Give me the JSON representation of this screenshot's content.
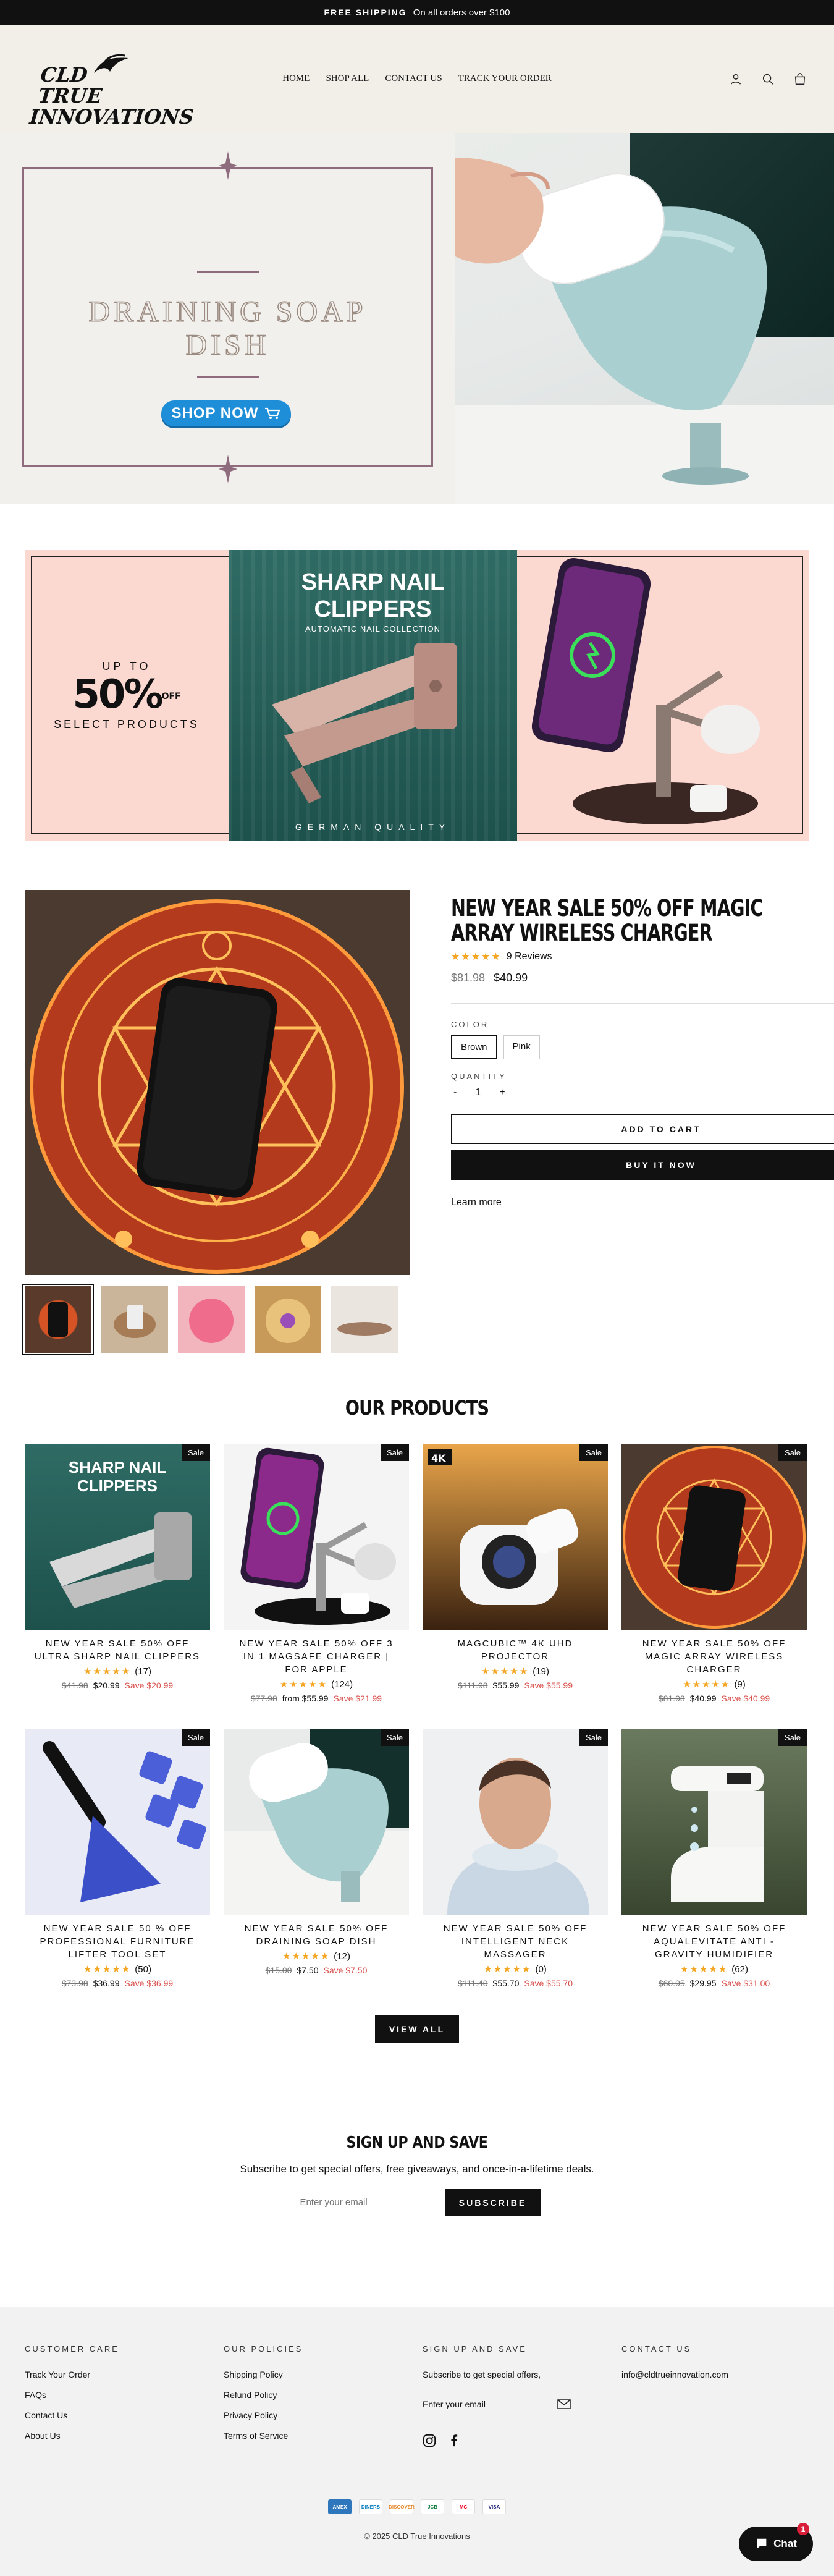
{
  "announcement": {
    "bold": "FREE SHIPPING",
    "text": "On all orders over $100"
  },
  "logo": {
    "line1": "CLD TRUE",
    "line2": "INNOVATIONS"
  },
  "nav": [
    "HOME",
    "SHOP ALL",
    "CONTACT US",
    "TRACK YOUR ORDER"
  ],
  "hero": {
    "title_line1": "DRAINING SOAP",
    "title_line2": "DISH",
    "button": "SHOP NOW"
  },
  "promo": {
    "up_to": "UP TO",
    "percent": "50%",
    "off": "OFF",
    "select": "SELECT PRODUCTS",
    "mid_title_1": "SHARP NAIL",
    "mid_title_2": "CLIPPERS",
    "mid_sub": "AUTOMATIC NAIL COLLECTION",
    "mid_footer": "GERMAN QUALITY"
  },
  "featured": {
    "title": "NEW YEAR SALE 50% OFF MAGIC ARRAY WIRELESS CHARGER",
    "stars": "★★★★★",
    "reviews": "9 Reviews",
    "price_old": "$81.98",
    "price_new": "$40.99",
    "color_label": "COLOR",
    "colors": [
      "Brown",
      "Pink"
    ],
    "quantity_label": "QUANTITY",
    "qty_minus": "-",
    "qty_value": "1",
    "qty_plus": "+",
    "add_to_cart": "ADD TO CART",
    "buy_now": "BUY IT NOW",
    "learn_more": "Learn more"
  },
  "products_title": "OUR PRODUCTS",
  "badge": "Sale",
  "products": [
    {
      "name": "NEW YEAR SALE 50% OFF ULTRA SHARP NAIL CLIPPERS",
      "stars": "★★★★★",
      "count": "(17)",
      "old": "$41.98",
      "new": "$20.99",
      "save": "Save $20.99"
    },
    {
      "name": "NEW YEAR SALE 50% OFF 3 IN 1 MAGSAFE CHARGER | FOR APPLE",
      "stars": "★★★★★",
      "count": "(124)",
      "old": "$77.98",
      "new": "from $55.99",
      "save": "Save $21.99"
    },
    {
      "name": "MAGCUBIC™ 4K UHD PROJECTOR",
      "stars": "★★★★★",
      "count": "(19)",
      "old": "$111.98",
      "new": "$55.99",
      "save": "Save $55.99"
    },
    {
      "name": "NEW YEAR SALE 50% OFF MAGIC ARRAY WIRELESS CHARGER",
      "stars": "★★★★★",
      "count": "(9)",
      "old": "$81.98",
      "new": "$40.99",
      "save": "Save $40.99"
    },
    {
      "name": "NEW YEAR SALE 50 % OFF PROFESSIONAL FURNITURE LIFTER TOOL SET",
      "stars": "★★★★★",
      "count": "(50)",
      "old": "$73.98",
      "new": "$36.99",
      "save": "Save $36.99"
    },
    {
      "name": "NEW YEAR SALE 50% OFF DRAINING SOAP DISH",
      "stars": "★★★★★",
      "count": "(12)",
      "old": "$15.00",
      "new": "$7.50",
      "save": "Save $7.50"
    },
    {
      "name": "NEW YEAR SALE 50% OFF INTELLIGENT NECK MASSAGER",
      "stars": "★★★★★",
      "count": "(0)",
      "old": "$111.40",
      "new": "$55.70",
      "save": "Save $55.70"
    },
    {
      "name": "NEW YEAR SALE 50% OFF AQUALEVITATE ANTI - GRAVITY HUMIDIFIER",
      "stars": "★★★★★",
      "count": "(62)",
      "old": "$60.95",
      "new": "$29.95",
      "save": "Save $31.00"
    }
  ],
  "view_all": "VIEW ALL",
  "signup": {
    "title": "SIGN UP AND SAVE",
    "text": "Subscribe to get special offers, free giveaways, and once-in-a-lifetime deals.",
    "placeholder": "Enter your email",
    "button": "SUBSCRIBE"
  },
  "footer": {
    "care_title": "CUSTOMER CARE",
    "care_links": [
      "Track Your Order",
      "FAQs",
      "Contact Us",
      "About Us"
    ],
    "policies_title": "OUR POLICIES",
    "policy_links": [
      "Shipping Policy",
      "Refund Policy",
      "Privacy Policy",
      "Terms of Service"
    ],
    "signup_title": "SIGN UP AND SAVE",
    "signup_text": "Subscribe to get special offers,",
    "email_placeholder": "Enter your email",
    "contact_title": "CONTACT US",
    "contact_email": "info@cldtrueinnovation.com",
    "payments": [
      "AMEX",
      "DINERS",
      "DISCOVER",
      "JCB",
      "MC",
      "VISA"
    ],
    "copyright": "© 2025 CLD True Innovations"
  },
  "chat": {
    "label": "Chat",
    "unread": "1"
  },
  "colors": {
    "accent_blue": "#1e8ed8",
    "frame_mauve": "#8e6c7e",
    "promo_pink": "#fbd9d1",
    "sale_red": "#d9534f",
    "star_gold": "#f4a623"
  }
}
